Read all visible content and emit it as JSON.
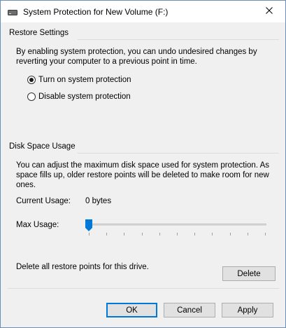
{
  "window": {
    "title": "System Protection for New Volume (F:)"
  },
  "restore_settings": {
    "group_title": "Restore Settings",
    "description": "By enabling system protection, you can undo undesired changes by reverting your computer to a previous point in time.",
    "options": [
      {
        "label": "Turn on system protection",
        "selected": true
      },
      {
        "label": "Disable system protection",
        "selected": false
      }
    ]
  },
  "disk_space": {
    "group_title": "Disk Space Usage",
    "description": "You can adjust the maximum disk space used for system protection. As space fills up, older restore points will be deleted to make room for new ones.",
    "current_usage_label": "Current Usage:",
    "current_usage_value": "0 bytes",
    "max_usage_label": "Max Usage:",
    "max_usage_fraction": 0
  },
  "delete_section": {
    "text": "Delete all restore points for this drive.",
    "button_label": "Delete"
  },
  "footer": {
    "ok_label": "OK",
    "cancel_label": "Cancel",
    "apply_label": "Apply"
  },
  "colors": {
    "accent": "#0078d7",
    "window_bg": "#f0f0f0",
    "button_bg": "#e1e1e1"
  },
  "icons": {
    "title": "drive-icon",
    "close": "close-icon"
  }
}
